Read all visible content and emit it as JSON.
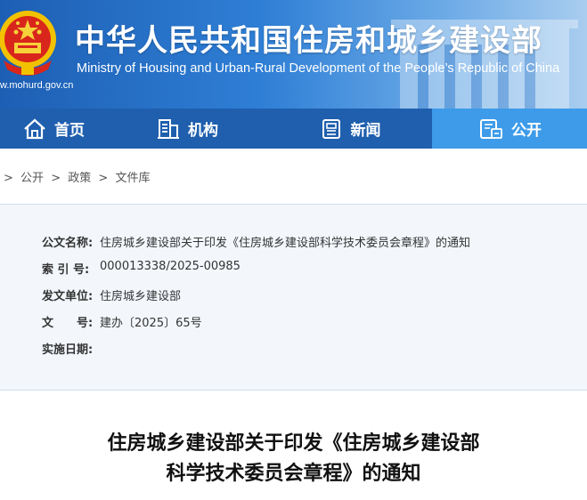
{
  "header": {
    "title_cn": "中华人民共和国住房和城乡建设部",
    "title_en": "Ministry of Housing and Urban-Rural Development of the People’s Republic of China",
    "url": "w.mohurd.gov.cn"
  },
  "nav": {
    "items": [
      {
        "label": "首页",
        "icon": "home-icon"
      },
      {
        "label": "机构",
        "icon": "building-icon"
      },
      {
        "label": "新闻",
        "icon": "news-icon"
      },
      {
        "label": "公开",
        "icon": "disclosure-icon",
        "active": true
      }
    ]
  },
  "breadcrumb": {
    "items": [
      "公开",
      "政策",
      "文件库"
    ],
    "separator": ">"
  },
  "document_info": {
    "title_label": "公文名称:",
    "title_value": "住房城乡建设部关于印发《住房城乡建设部科学技术委员会章程》的通知",
    "index_label": "索 引 号:",
    "index_value": "000013338/2025-00985",
    "issuer_label": "发文单位:",
    "issuer_value": "住房城乡建设部",
    "number_label": "文　　号:",
    "number_value": "建办〔2025〕65号",
    "date_label": "实施日期:",
    "date_value": ""
  },
  "document_title": {
    "line1": "住房城乡建设部关于印发《住房城乡建设部",
    "line2": "科学技术委员会章程》的通知"
  },
  "colors": {
    "nav_bg": "#1f5fae",
    "nav_active": "#3d9be9",
    "info_bg": "#f3f7fc"
  }
}
